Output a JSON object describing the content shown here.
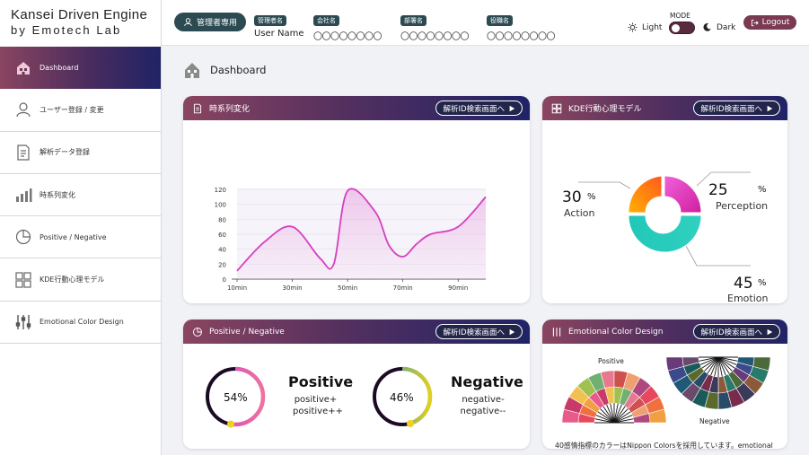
{
  "brand": {
    "line1": "Kansei Driven Engine",
    "line2": "by Emotech Lab"
  },
  "sidebar": {
    "items": [
      {
        "label": "Dashboard",
        "icon": "home-icon",
        "active": true
      },
      {
        "label": "ユーザー登録 / 変更",
        "icon": "user-icon"
      },
      {
        "label": "解析データ登録",
        "icon": "document-icon"
      },
      {
        "label": "時系列変化",
        "icon": "bar-chart-icon"
      },
      {
        "label": "Positive / Negative",
        "icon": "pie-icon"
      },
      {
        "label": "KDE行動心理モデル",
        "icon": "grid-icon"
      },
      {
        "label": "Emotional Color Design",
        "icon": "sliders-icon"
      }
    ]
  },
  "header": {
    "admin_badge": "管理者専用",
    "fields": [
      {
        "tag": "管理者名",
        "value": "User Name"
      },
      {
        "tag": "会社名",
        "value": "〇〇〇〇〇〇〇〇"
      },
      {
        "tag": "部署名",
        "value": "〇〇〇〇〇〇〇〇"
      },
      {
        "tag": "役職名",
        "value": "〇〇〇〇〇〇〇〇"
      }
    ],
    "mode_label": "MODE",
    "light_label": "Light",
    "dark_label": "Dark",
    "logout_label": "Logout"
  },
  "main": {
    "title": "Dashboard"
  },
  "cards": {
    "timeseries": {
      "title": "時系列変化",
      "button": "解析ID検索画面へ"
    },
    "kde": {
      "title": "KDE行動心理モデル",
      "button": "解析ID検索画面へ"
    },
    "posneg": {
      "title": "Positive / Negative",
      "button": "解析ID検索画面へ"
    },
    "color": {
      "title": "Emotional Color Design",
      "button": "解析ID検索画面へ"
    }
  },
  "kde_model": {
    "action": {
      "value": "30",
      "unit": "%",
      "label": "Action"
    },
    "perception": {
      "value": "25",
      "unit": "%",
      "label": "Perception"
    },
    "emotion": {
      "value": "45",
      "unit": "%",
      "label": "Emotion"
    }
  },
  "posneg": {
    "positive": {
      "percent_label": "54%",
      "title": "Positive",
      "sub1": "positive+",
      "sub2": "positive++",
      "value": 54
    },
    "negative": {
      "percent_label": "46%",
      "title": "Negative",
      "sub1": "negative-",
      "sub2": "negative--",
      "value": 46
    }
  },
  "color_design": {
    "positive_label": "Positive",
    "negative_label": "Negative",
    "note": "40感情指標のカラーはNippon Colorsを採用しています。emotional"
  },
  "chart_data": {
    "type": "line",
    "x": [
      10,
      20,
      30,
      40,
      45,
      50,
      60,
      65,
      70,
      75,
      80,
      90,
      100
    ],
    "values": [
      11,
      50,
      70,
      28,
      20,
      118,
      90,
      45,
      30,
      47,
      60,
      70,
      110
    ],
    "xtick_labels": [
      "10min",
      "30min",
      "50min",
      "70min",
      "90min"
    ],
    "xticks": [
      10,
      30,
      50,
      70,
      90
    ],
    "yticks": [
      0,
      20,
      40,
      60,
      80,
      100,
      120
    ],
    "ylim": [
      0,
      120
    ],
    "xlim": [
      10,
      100
    ],
    "line_color": "#d63fbf",
    "fill": true,
    "grid": true
  },
  "colors": {
    "accent": "#2c4a52",
    "card_head_start": "#8a4560",
    "card_head_end": "#1f2366"
  }
}
